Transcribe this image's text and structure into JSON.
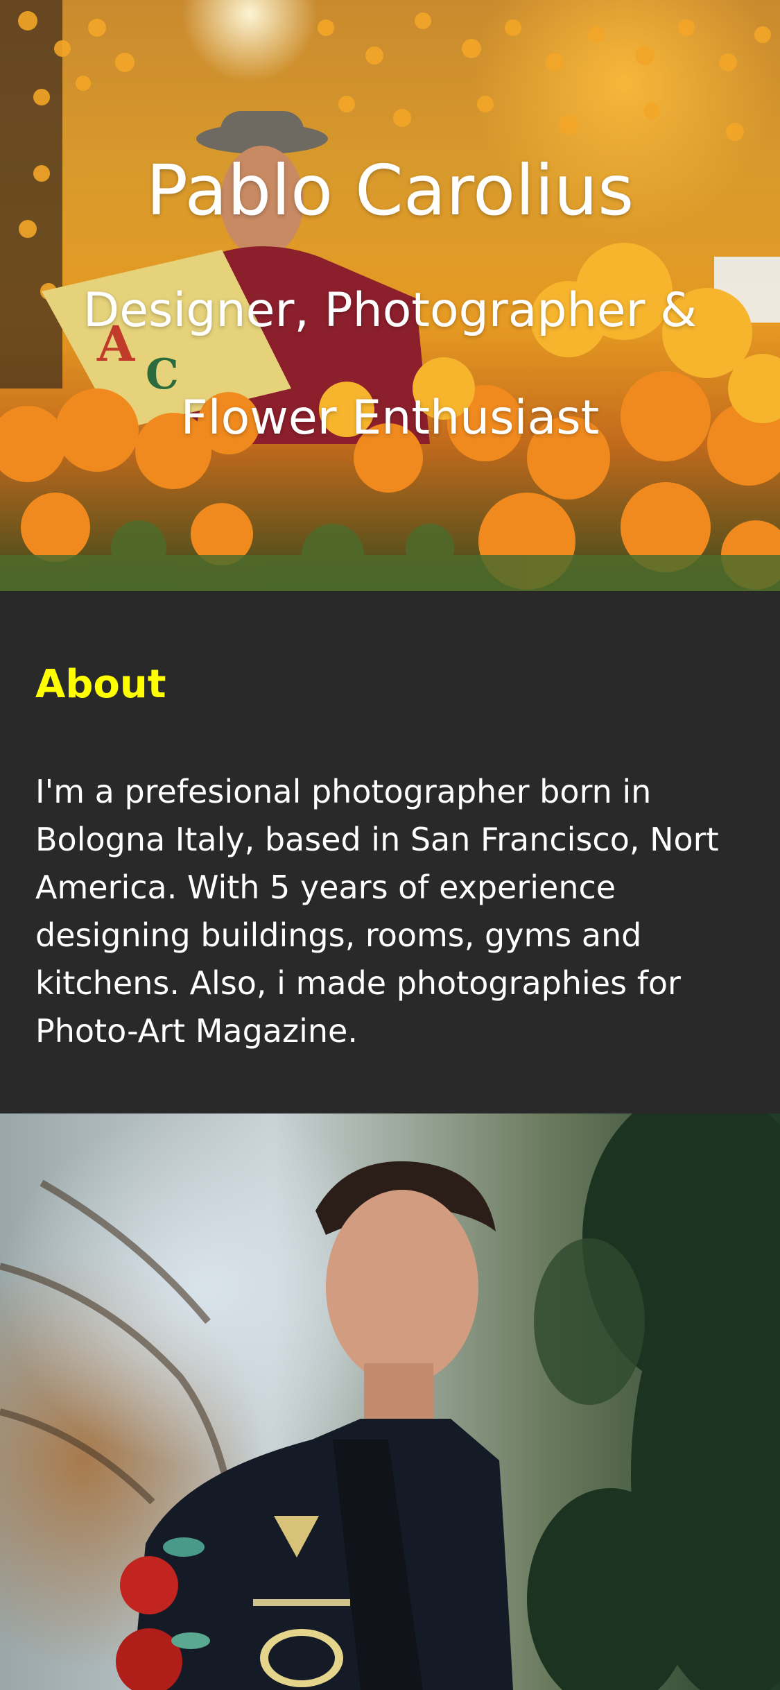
{
  "hero": {
    "name": "Pablo Carolius",
    "subtitle_line1": "Designer, Photographer &",
    "subtitle_line2": "Flower Enthusiast"
  },
  "about": {
    "heading": "About",
    "body": "I'm a prefesional photographer born in Bologna Italy, based in San Francisco, Nort America. With 5 years of experience designing buildings, rooms, gyms and kitchens. Also, i made photographies for Photo-Art Magazine."
  },
  "colors": {
    "page_background": "#292929",
    "heading_accent": "#ffff00",
    "text": "#ffffff"
  }
}
